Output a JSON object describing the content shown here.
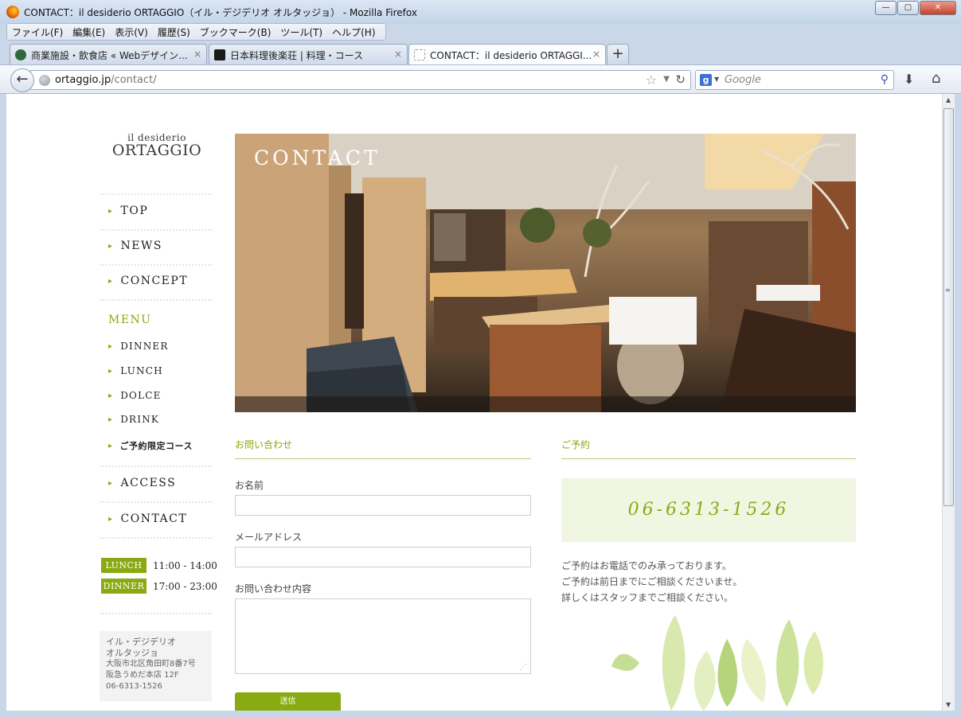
{
  "browser": {
    "window_title": "CONTACT：il desiderio ORTAGGIO（イル・デジデリオ オルタッジョ） - Mozilla Firefox",
    "menu": [
      "ファイル(F)",
      "編集(E)",
      "表示(V)",
      "履歴(S)",
      "ブックマーク(B)",
      "ツール(T)",
      "ヘルプ(H)"
    ],
    "tabs": [
      {
        "label": "商業施設・飲食店 « Webデザイン...",
        "favicon_color": "#2f6b3a",
        "active": false
      },
      {
        "label": "日本料理後楽荘 | 料理・コース",
        "favicon_color": "#1a1a1a",
        "active": false
      },
      {
        "label": "CONTACT：il desiderio ORTAGGI...",
        "favicon_color": "#ffffff",
        "active": true
      }
    ],
    "url_domain": "ortaggio.jp",
    "url_path": "/contact/",
    "search_placeholder": "Google",
    "window_buttons": {
      "minimize": "—",
      "maximize": "▢",
      "close": "✕"
    }
  },
  "site": {
    "logo_small": "il desiderio",
    "logo_big": "ORTAGGIO",
    "nav": {
      "top": "TOP",
      "news": "NEWS",
      "concept": "CONCEPT",
      "menu_heading": "MENU",
      "dinner": "DINNER",
      "lunch": "LUNCH",
      "dolce": "DOLCE",
      "drink": "DRINK",
      "course": "ご予約限定コース",
      "access": "ACCESS",
      "contact": "CONTACT"
    },
    "hours": [
      {
        "label": "LUNCH",
        "time": "11:00 - 14:00"
      },
      {
        "label": "DINNER",
        "time": "17:00 - 23:00"
      }
    ],
    "address": {
      "name1": "イル・デジデリオ",
      "name2": "オルタッジョ",
      "line1": "大阪市北区角田町8番7号",
      "line2": "阪急うめだ本店 12F",
      "phone": "06-6313-1526"
    },
    "hero_title": "CONTACT",
    "form": {
      "heading": "お問い合わせ",
      "name_label": "お名前",
      "email_label": "メールアドレス",
      "message_label": "お問い合わせ内容",
      "submit_label": "送信"
    },
    "reservation": {
      "heading": "ご予約",
      "phone": "06-6313-1526",
      "line1": "ご予約はお電話でのみ承っております。",
      "line2": "ご予約は前日までにご相談くださいませ。",
      "line3": "詳しくはスタッフまでご相談ください。"
    },
    "accent_color": "#8aaa12"
  }
}
